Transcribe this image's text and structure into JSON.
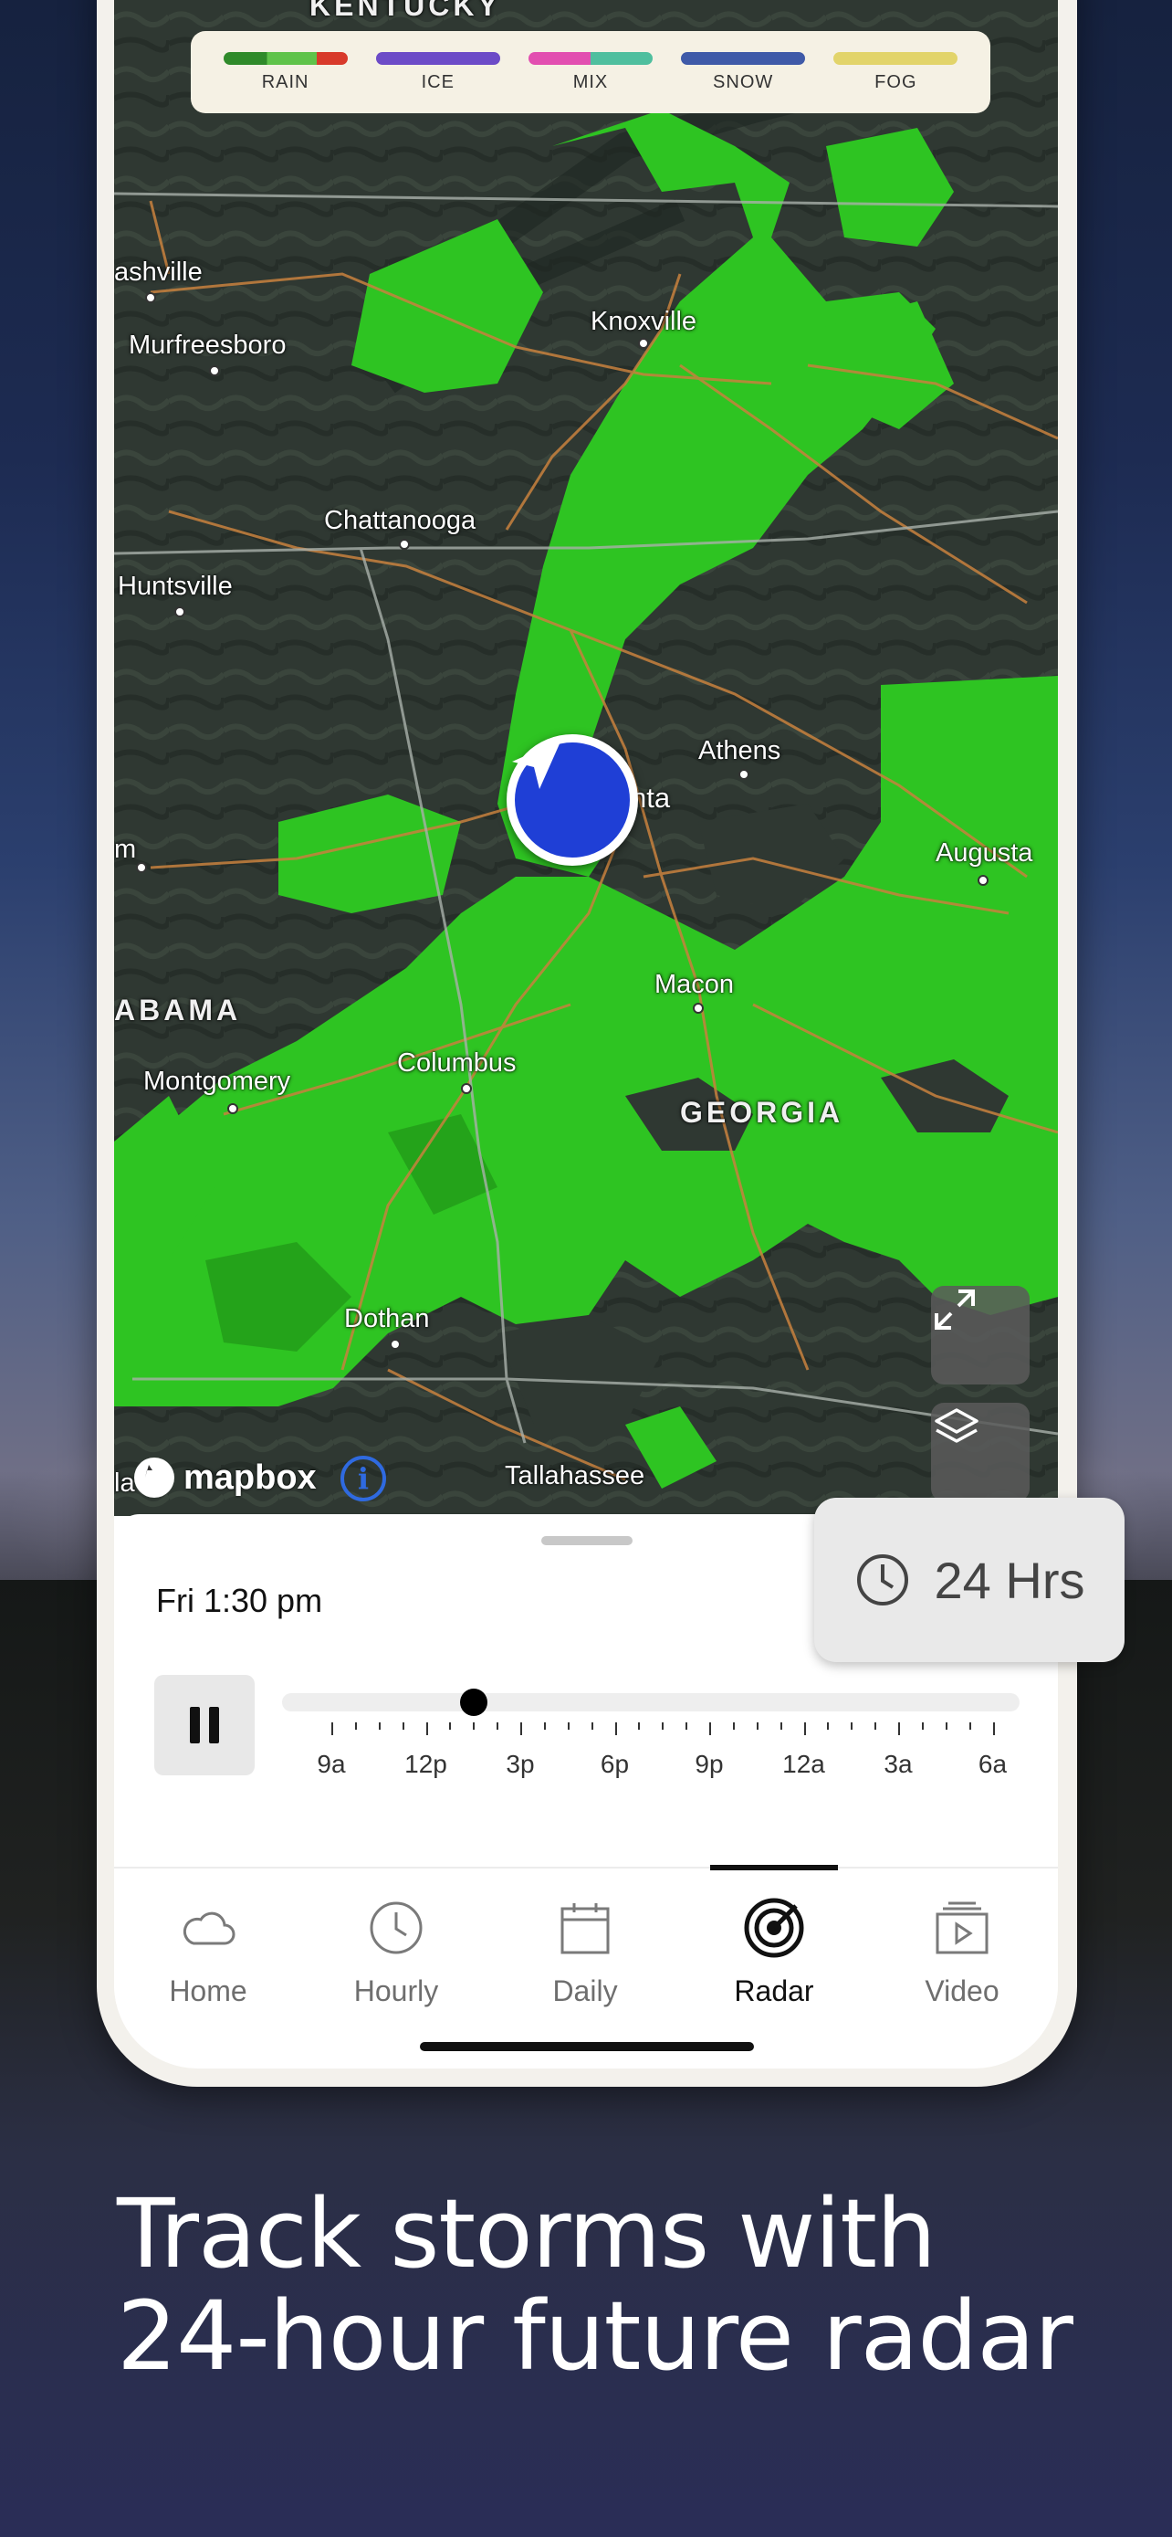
{
  "headline": {
    "line1": "Track storms with",
    "line2": "24-hour future radar"
  },
  "legend": [
    {
      "label": "RAIN",
      "colors": [
        "#2f8a2a",
        "#5fc34a",
        "#d83a2a"
      ]
    },
    {
      "label": "ICE",
      "colors": [
        "#6c4bc7"
      ]
    },
    {
      "label": "MIX",
      "colors": [
        "#e24fb0",
        "#4fbf9e"
      ]
    },
    {
      "label": "SNOW",
      "colors": [
        "#3f5aa8"
      ]
    },
    {
      "label": "FOG",
      "colors": [
        "#e2d46a"
      ]
    }
  ],
  "map": {
    "states": [
      "KENTUCKY",
      "ABAMA",
      "GEORGIA"
    ],
    "cities": [
      "ashville",
      "Murfreesboro",
      "Knoxville",
      "Chattanooga",
      "Huntsville",
      "Athens",
      "nta",
      "m",
      "Augusta",
      "Macon",
      "Montgomery",
      "Columbus",
      "Dothan",
      "Tallahassee",
      "la"
    ],
    "attribution": "mapbox",
    "info_icon": "info-icon",
    "buttons": [
      "expand-icon",
      "layers-icon"
    ]
  },
  "player": {
    "time": "Fri 1:30 pm",
    "range_label": "24 Hrs",
    "progress": 0.26,
    "tick_labels": [
      "9a",
      "12p",
      "3p",
      "6p",
      "9p",
      "12a",
      "3a",
      "6a"
    ]
  },
  "tabs": [
    {
      "label": "Home",
      "icon": "cloud-icon",
      "active": false
    },
    {
      "label": "Hourly",
      "icon": "clock-icon",
      "active": false
    },
    {
      "label": "Daily",
      "icon": "calendar-icon",
      "active": false
    },
    {
      "label": "Radar",
      "icon": "radar-icon",
      "active": true
    },
    {
      "label": "Video",
      "icon": "video-icon",
      "active": false
    }
  ],
  "colors": {
    "radar_green": "#2ec422",
    "marker_blue": "#1f3fd6",
    "map_dark": "#2d3530"
  }
}
